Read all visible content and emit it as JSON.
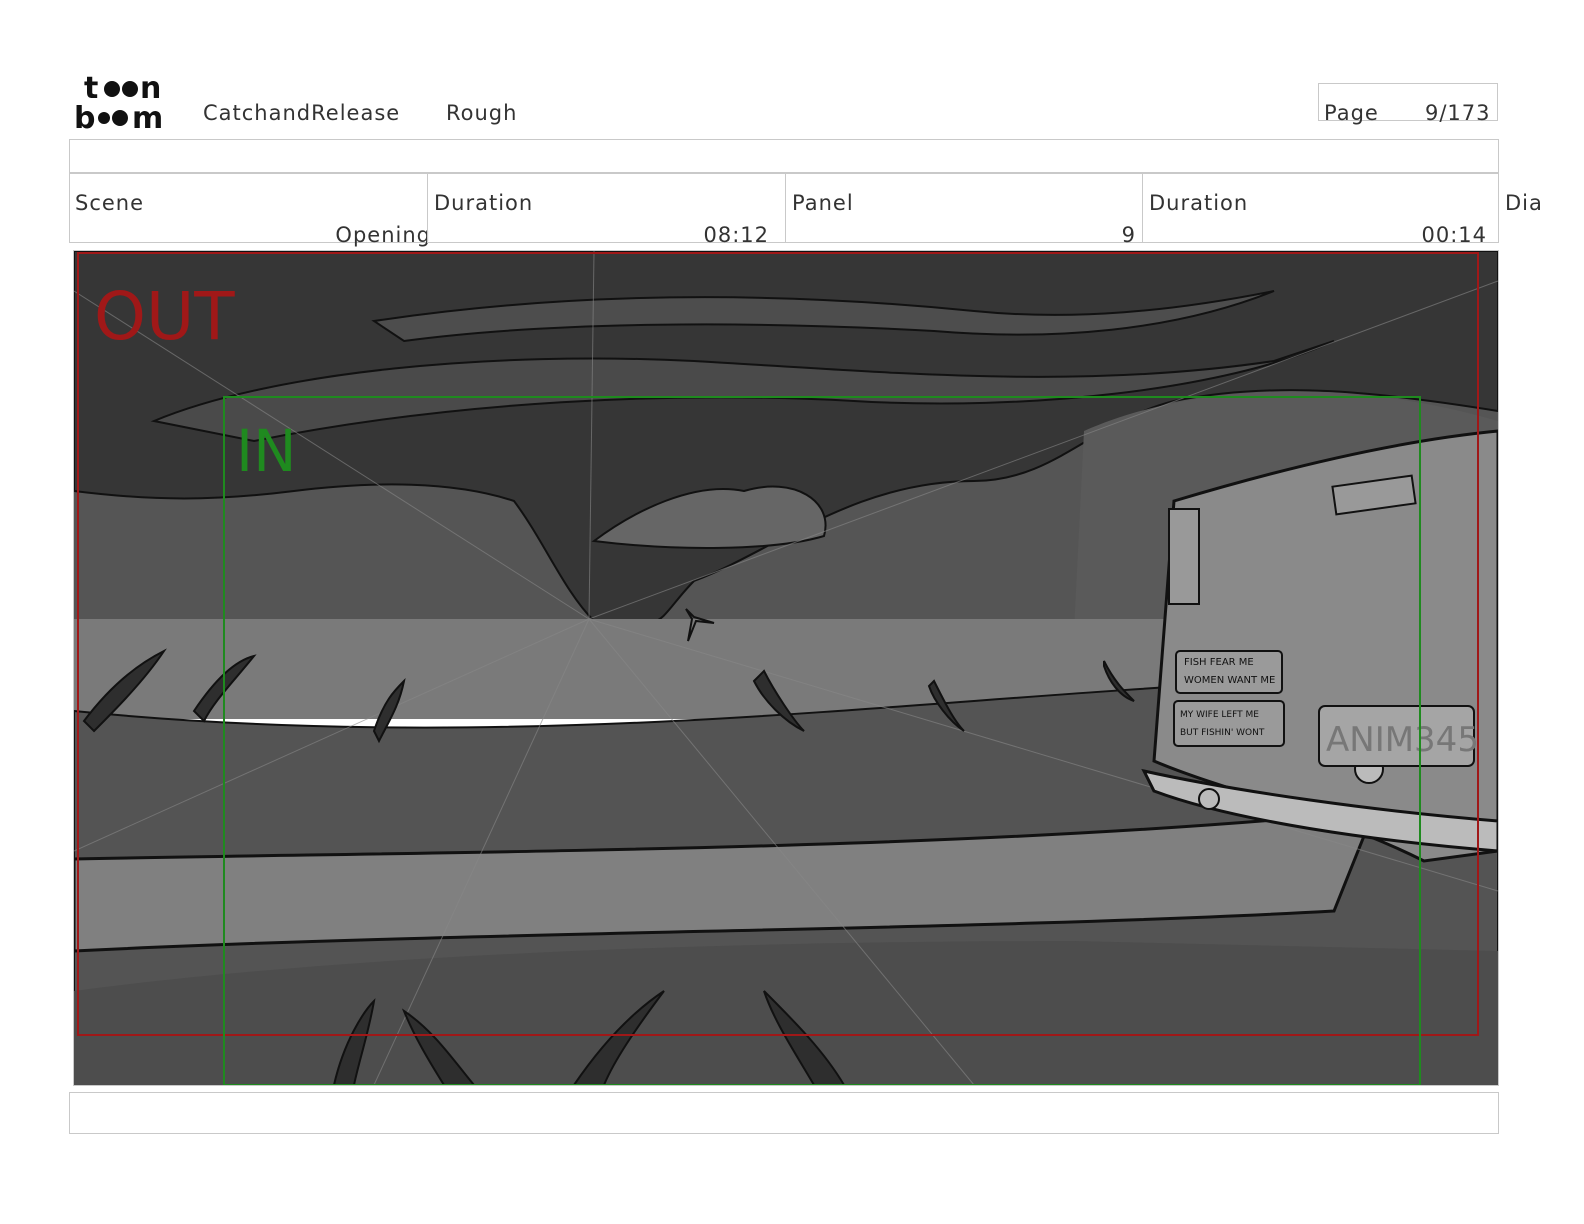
{
  "header": {
    "logo_text": "toon boom",
    "project": "CatchandRelease",
    "version": "Rough",
    "page_label": "Page",
    "page_value": "9/173"
  },
  "info_row": {
    "scene": {
      "label": "Scene",
      "value": "Opening"
    },
    "scene_duration": {
      "label": "Duration",
      "value": "08:12"
    },
    "panel": {
      "label": "Panel",
      "value": "9"
    },
    "panel_duration": {
      "label": "Duration",
      "value": "00:14"
    },
    "dialogue_label": "Dia"
  },
  "panel_image": {
    "out_label": "OUT",
    "in_label": "IN",
    "bumper_sticker_top": [
      "FISH FEAR ME",
      "WOMEN WANT ME"
    ],
    "bumper_sticker_bottom": [
      "MY WIFE LEFT ME",
      "BUT FISHIN' WONT"
    ],
    "license_plate": "ANIM345",
    "colors": {
      "out_frame": "#a01818",
      "in_frame": "#1f8a1f",
      "sky": "#3a3a3a",
      "ground": "#5a5a5a"
    }
  }
}
